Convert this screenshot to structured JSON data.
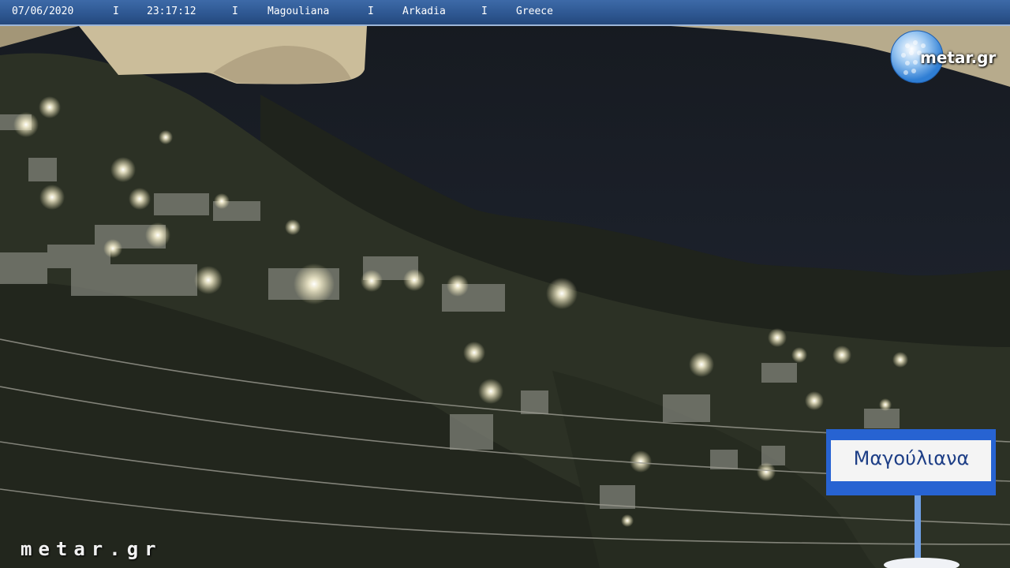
{
  "header": {
    "date": "07/06/2020",
    "time": "23:17:12",
    "village": "Magouliana",
    "region": "Arkadia",
    "country": "Greece",
    "separator": "I"
  },
  "logo": {
    "text": "metar.gr",
    "icon": "golf-ball-globe-icon"
  },
  "watermark": {
    "text": "metar.gr"
  },
  "sign": {
    "text": "Μαγούλιανα",
    "colors": {
      "blue": "#1d58c8",
      "white": "#f4f4f4"
    }
  },
  "colors": {
    "bar": "#2d5690",
    "sky": "#1b2230",
    "hillside": "#2b3024",
    "light": "#fff6d8"
  }
}
